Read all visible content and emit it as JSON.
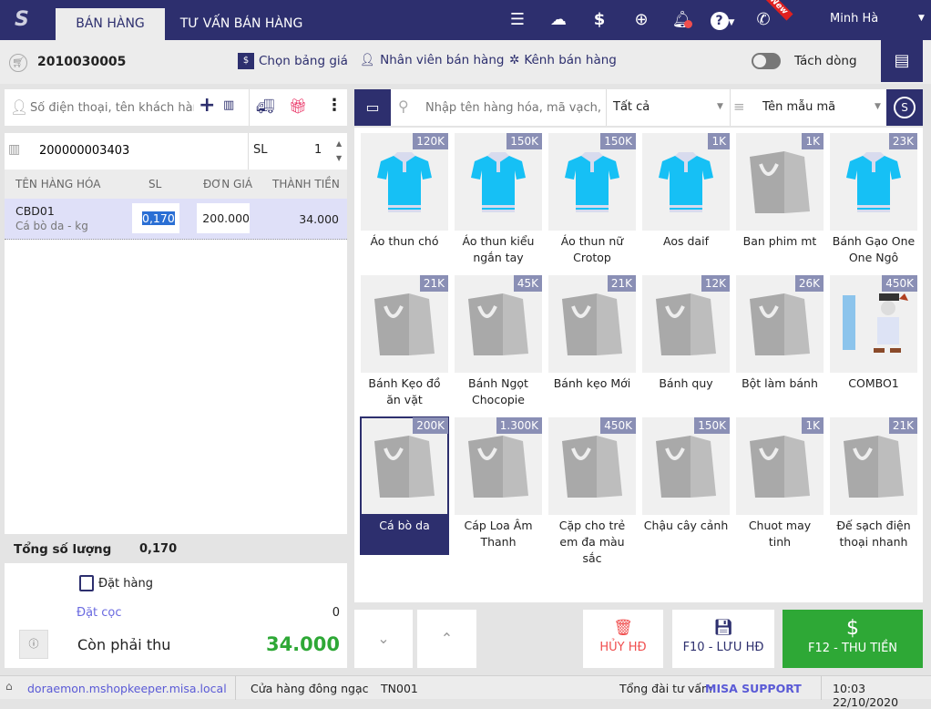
{
  "topbar": {
    "tabs": [
      "BÁN HÀNG",
      "TƯ VẤN BÁN HÀNG"
    ],
    "new_badge": "New",
    "user": "Minh Hà"
  },
  "toolbar": {
    "invoice_no": "2010030005",
    "price_list": "Chọn bảng giá",
    "staff": "Nhân viên bán hàng",
    "channel": "Kênh bán hàng",
    "split_line": "Tách dòng",
    "split_on": false
  },
  "customer": {
    "placeholder": "Số điện thoại, tên khách hàng"
  },
  "barcode": {
    "value": "200000003403",
    "qty_label": "SL",
    "qty": "1"
  },
  "cart": {
    "headers": [
      "TÊN HÀNG HÓA",
      "SL",
      "ĐƠN GIÁ",
      "THÀNH TIỀN"
    ],
    "rows": [
      {
        "code": "CBD01",
        "name": "Cá bò da - kg",
        "qty": "0,170",
        "price": "200.000",
        "total": "34.000"
      }
    ]
  },
  "summary": {
    "total_qty_label": "Tổng số lượng",
    "total_qty": "0,170",
    "order_label": "Đặt hàng",
    "deposit_label": "Đặt cọc",
    "deposit": "0",
    "remain_label": "Còn phải thu",
    "remain": "34.000"
  },
  "search": {
    "placeholder": "Nhập tên hàng hóa, mã vạch, mã",
    "category": "Tất cả",
    "sort": "Tên mẫu mã"
  },
  "products": [
    {
      "name": "Áo thun chó",
      "price": "120K",
      "img": "shirt"
    },
    {
      "name": "Áo thun kiểu ngắn tay",
      "price": "150K",
      "img": "shirt"
    },
    {
      "name": "Áo thun nữ Crotop",
      "price": "150K",
      "img": "shirt"
    },
    {
      "name": "Aos daif",
      "price": "1K",
      "img": "shirt"
    },
    {
      "name": "Ban phim mt",
      "price": "1K",
      "img": "bag"
    },
    {
      "name": "Bánh Gạo One One Ngô",
      "price": "23K",
      "img": "shirt"
    },
    {
      "name": "Bánh Kẹo đồ ăn vặt",
      "price": "21K",
      "img": "bag"
    },
    {
      "name": "Bánh Ngọt Chocopie",
      "price": "45K",
      "img": "bag"
    },
    {
      "name": "Bánh kẹo Mới",
      "price": "21K",
      "img": "bag"
    },
    {
      "name": "Bánh quy",
      "price": "12K",
      "img": "bag"
    },
    {
      "name": "Bột làm bánh",
      "price": "26K",
      "img": "bag"
    },
    {
      "name": "COMBO1",
      "price": "450K",
      "img": "combo"
    },
    {
      "name": "Cá bò da",
      "price": "200K",
      "img": "bag",
      "selected": true
    },
    {
      "name": "Cáp Loa Âm Thanh",
      "price": "1.300K",
      "img": "bag"
    },
    {
      "name": "Cặp cho trẻ em đa màu sắc",
      "price": "450K",
      "img": "bag"
    },
    {
      "name": "Chậu cây cảnh",
      "price": "150K",
      "img": "bag"
    },
    {
      "name": "Chuot may tinh",
      "price": "1K",
      "img": "bag"
    },
    {
      "name": "Đế sạch điện thoại nhanh",
      "price": "21K",
      "img": "bag"
    }
  ],
  "actions": {
    "cancel": "HỦY HĐ",
    "save": "F10 - LƯU HĐ",
    "pay": "F12 - THU TIỀN"
  },
  "status": {
    "domain": "doraemon.mshopkeeper.misa.local",
    "store": "Cửa hàng đông ngạc",
    "code": "TN001",
    "support_label": "Tổng đài tư vấn:",
    "support": "MISA SUPPORT",
    "datetime": "10:03 22/10/2020"
  },
  "colors": {
    "navy": "#2d2f6e",
    "green": "#2ea836",
    "red": "#f04e4e"
  }
}
